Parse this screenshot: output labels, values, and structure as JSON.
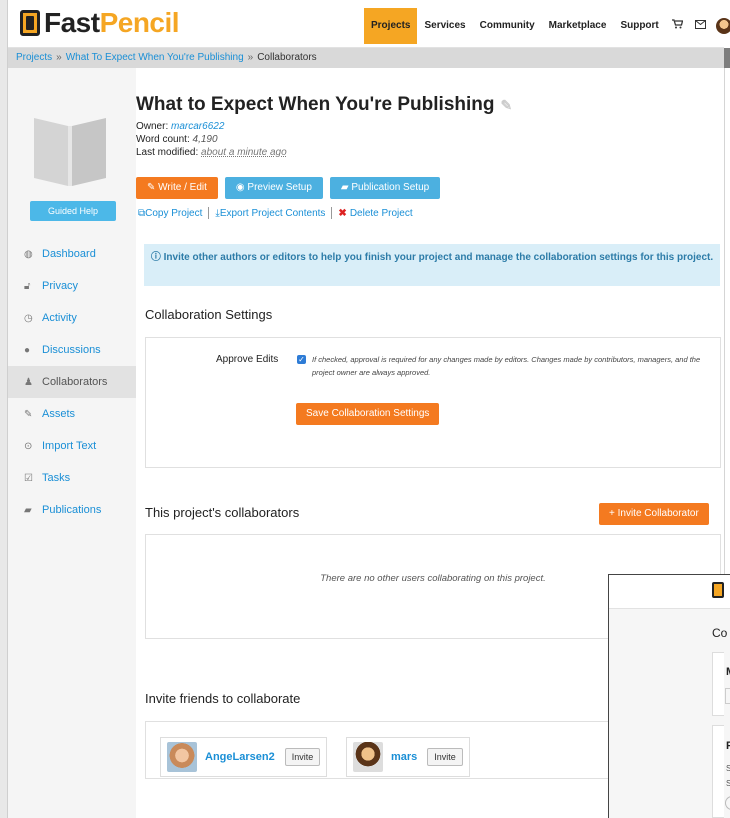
{
  "header": {
    "logo_fast": "Fast",
    "logo_pencil": "Pencil",
    "nav": [
      "Projects",
      "Services",
      "Community",
      "Marketplace",
      "Support"
    ],
    "icons": [
      "cart-icon",
      "mail-icon",
      "avatar"
    ]
  },
  "breadcrumb": {
    "items": [
      "Projects",
      "What To Expect When You're Publishing",
      "Collaborators"
    ],
    "separator": "»"
  },
  "sidebar": {
    "guided_help": "Guided Help",
    "items": [
      {
        "label": "Dashboard",
        "icon": "dashboard-icon"
      },
      {
        "label": "Privacy",
        "icon": "lock-icon"
      },
      {
        "label": "Activity",
        "icon": "clock-icon"
      },
      {
        "label": "Discussions",
        "icon": "chat-icon"
      },
      {
        "label": "Collaborators",
        "icon": "person-icon",
        "active": true
      },
      {
        "label": "Assets",
        "icon": "paperclip-icon"
      },
      {
        "label": "Import Text",
        "icon": "upload-icon"
      },
      {
        "label": "Tasks",
        "icon": "checkbox-icon"
      },
      {
        "label": "Publications",
        "icon": "book-icon"
      }
    ]
  },
  "project": {
    "title": "What to Expect When You're Publishing",
    "owner_label": "Owner:",
    "owner": "marcar6622",
    "wordcount_label": "Word count:",
    "wordcount": "4,190",
    "modified_label": "Last modified:",
    "modified": "about a minute ago"
  },
  "actions": {
    "write_edit": "Write / Edit",
    "preview_setup": "Preview Setup",
    "publication_setup": "Publication Setup",
    "copy_project": "Copy Project",
    "export_contents": "Export Project Contents",
    "delete_project": "Delete Project"
  },
  "alert": {
    "text": "Invite other authors or editors to help you finish your project and manage the collaboration settings for this project."
  },
  "collab_settings": {
    "heading": "Collaboration Settings",
    "approve_label": "Approve Edits",
    "approve_checked": true,
    "approve_help": "If checked, approval is required for any changes made by editors. Changes made by contributors, managers, and the project owner are always approved.",
    "save_button": "Save Collaboration Settings"
  },
  "collaborators": {
    "heading": "This project's collaborators",
    "invite_button": "Invite Collaborator",
    "empty_message": "There are no other users collaborating on this project."
  },
  "invite_friends": {
    "heading": "Invite friends to collaborate",
    "friends": [
      {
        "name": "AngeLarsen2",
        "button": "Invite"
      },
      {
        "name": "mars",
        "button": "Invite"
      }
    ]
  },
  "overlay_window": {
    "title_fragment": "Co",
    "card_letters": [
      "M",
      "F"
    ],
    "line_letters": [
      "S",
      "S"
    ]
  },
  "colors": {
    "brand_orange": "#f5a623",
    "button_orange": "#f47a20",
    "button_blue": "#4cb0e0",
    "link_blue": "#1a8fd6",
    "alert_bg": "#d9eef8"
  }
}
